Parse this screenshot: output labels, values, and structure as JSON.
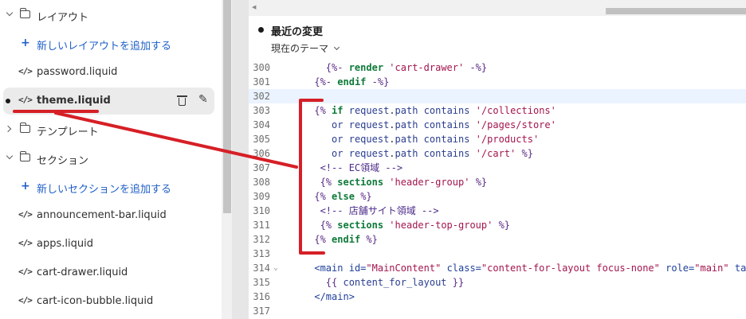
{
  "sidebar": {
    "rows": [
      {
        "type": "folder",
        "expanded": true,
        "label": "レイアウト",
        "icon": "folder-icon"
      },
      {
        "type": "add",
        "label": "新しいレイアウトを追加する",
        "icon": "plus-icon"
      },
      {
        "type": "file",
        "label": "password.liquid",
        "icon": "code-file-icon"
      },
      {
        "type": "file",
        "active": true,
        "modified": true,
        "label": "theme.liquid",
        "icon": "code-file-icon"
      },
      {
        "type": "folder",
        "expanded": false,
        "label": "テンプレート",
        "icon": "folder-icon"
      },
      {
        "type": "folder",
        "expanded": true,
        "label": "セクション",
        "icon": "folder-icon"
      },
      {
        "type": "add",
        "label": "新しいセクションを追加する",
        "icon": "plus-icon"
      },
      {
        "type": "file",
        "label": "announcement-bar.liquid",
        "icon": "code-file-icon"
      },
      {
        "type": "file",
        "label": "apps.liquid",
        "icon": "code-file-icon"
      },
      {
        "type": "file",
        "label": "cart-drawer.liquid",
        "icon": "code-file-icon"
      },
      {
        "type": "file",
        "label": "cart-icon-bubble.liquid",
        "icon": "code-file-icon"
      }
    ],
    "code_icon_glyph": "</>",
    "plus_glyph": "+",
    "pencil_glyph": "✎",
    "accent_color": "#1f5fc7"
  },
  "editor": {
    "changes_title": "最近の変更",
    "theme_select_value": "現在のテーマ",
    "lines": [
      {
        "n": "300",
        "fold": "",
        "hl": false,
        "tokens": [
          [
            "n",
            "        "
          ],
          [
            "p",
            "{%- "
          ],
          [
            "k",
            "render"
          ],
          [
            "n",
            " "
          ],
          [
            "s",
            "'cart-drawer'"
          ],
          [
            "n",
            " "
          ],
          [
            "p",
            "-%}"
          ]
        ]
      },
      {
        "n": "301",
        "fold": "",
        "hl": false,
        "tokens": [
          [
            "n",
            "      "
          ],
          [
            "p",
            "{%- "
          ],
          [
            "k",
            "endif"
          ],
          [
            "n",
            " "
          ],
          [
            "p",
            "-%}"
          ]
        ]
      },
      {
        "n": "302",
        "fold": "",
        "hl": true,
        "tokens": [
          [
            "n",
            ""
          ]
        ]
      },
      {
        "n": "303",
        "fold": "",
        "hl": false,
        "tokens": [
          [
            "n",
            "      "
          ],
          [
            "p",
            "{% "
          ],
          [
            "k",
            "if"
          ],
          [
            "n",
            " "
          ],
          [
            "v",
            "request"
          ],
          [
            "n",
            "."
          ],
          [
            "v",
            "path"
          ],
          [
            "n",
            " "
          ],
          [
            "v",
            "contains"
          ],
          [
            "n",
            " "
          ],
          [
            "s",
            "'/collections'"
          ]
        ]
      },
      {
        "n": "304",
        "fold": "",
        "hl": false,
        "tokens": [
          [
            "n",
            "         "
          ],
          [
            "v",
            "or"
          ],
          [
            "n",
            " "
          ],
          [
            "v",
            "request"
          ],
          [
            "n",
            "."
          ],
          [
            "v",
            "path"
          ],
          [
            "n",
            " "
          ],
          [
            "v",
            "contains"
          ],
          [
            "n",
            " "
          ],
          [
            "s",
            "'/pages/store'"
          ]
        ]
      },
      {
        "n": "305",
        "fold": "",
        "hl": false,
        "tokens": [
          [
            "n",
            "         "
          ],
          [
            "v",
            "or"
          ],
          [
            "n",
            " "
          ],
          [
            "v",
            "request"
          ],
          [
            "n",
            "."
          ],
          [
            "v",
            "path"
          ],
          [
            "n",
            " "
          ],
          [
            "v",
            "contains"
          ],
          [
            "n",
            " "
          ],
          [
            "s",
            "'/products'"
          ]
        ]
      },
      {
        "n": "306",
        "fold": "",
        "hl": false,
        "tokens": [
          [
            "n",
            "         "
          ],
          [
            "v",
            "or"
          ],
          [
            "n",
            " "
          ],
          [
            "v",
            "request"
          ],
          [
            "n",
            "."
          ],
          [
            "v",
            "path"
          ],
          [
            "n",
            " "
          ],
          [
            "v",
            "contains"
          ],
          [
            "n",
            " "
          ],
          [
            "s",
            "'/cart'"
          ],
          [
            "n",
            " "
          ],
          [
            "p",
            "%}"
          ]
        ]
      },
      {
        "n": "307",
        "fold": "",
        "hl": false,
        "tokens": [
          [
            "n",
            "       "
          ],
          [
            "c",
            "<!-- EC領域 -->"
          ]
        ]
      },
      {
        "n": "308",
        "fold": "",
        "hl": false,
        "tokens": [
          [
            "n",
            "       "
          ],
          [
            "p",
            "{% "
          ],
          [
            "k",
            "sections"
          ],
          [
            "n",
            " "
          ],
          [
            "s",
            "'header-group'"
          ],
          [
            "n",
            " "
          ],
          [
            "p",
            "%}"
          ]
        ]
      },
      {
        "n": "309",
        "fold": "",
        "hl": false,
        "tokens": [
          [
            "n",
            "      "
          ],
          [
            "p",
            "{% "
          ],
          [
            "k",
            "else"
          ],
          [
            "n",
            " "
          ],
          [
            "p",
            "%}"
          ]
        ]
      },
      {
        "n": "310",
        "fold": "",
        "hl": false,
        "tokens": [
          [
            "n",
            "       "
          ],
          [
            "c",
            "<!-- 店舗サイト領域 -->"
          ]
        ]
      },
      {
        "n": "311",
        "fold": "",
        "hl": false,
        "tokens": [
          [
            "n",
            "       "
          ],
          [
            "p",
            "{% "
          ],
          [
            "k",
            "sections"
          ],
          [
            "n",
            " "
          ],
          [
            "s",
            "'header-top-group'"
          ],
          [
            "n",
            " "
          ],
          [
            "p",
            "%}"
          ]
        ]
      },
      {
        "n": "312",
        "fold": "",
        "hl": false,
        "tokens": [
          [
            "n",
            "      "
          ],
          [
            "p",
            "{% "
          ],
          [
            "k",
            "endif"
          ],
          [
            "n",
            " "
          ],
          [
            "p",
            "%}"
          ]
        ]
      },
      {
        "n": "313",
        "fold": "",
        "hl": false,
        "tokens": [
          [
            "n",
            ""
          ]
        ]
      },
      {
        "n": "314",
        "fold": "⌄",
        "hl": false,
        "tokens": [
          [
            "n",
            "      "
          ],
          [
            "t",
            "<main"
          ],
          [
            "n",
            " "
          ],
          [
            "a",
            "id="
          ],
          [
            "s",
            "\"MainContent\""
          ],
          [
            "n",
            " "
          ],
          [
            "a",
            "class="
          ],
          [
            "s",
            "\"content-for-layout focus-none\""
          ],
          [
            "n",
            " "
          ],
          [
            "a",
            "role="
          ],
          [
            "s",
            "\"main\""
          ],
          [
            "n",
            " "
          ],
          [
            "a",
            "tabind"
          ]
        ]
      },
      {
        "n": "315",
        "fold": "",
        "hl": false,
        "tokens": [
          [
            "n",
            "        "
          ],
          [
            "p",
            "{{ "
          ],
          [
            "v",
            "content_for_layout"
          ],
          [
            "n",
            " "
          ],
          [
            "p",
            "}}"
          ]
        ]
      },
      {
        "n": "316",
        "fold": "",
        "hl": false,
        "tokens": [
          [
            "n",
            "      "
          ],
          [
            "t",
            "</main>"
          ]
        ]
      },
      {
        "n": "317",
        "fold": "",
        "hl": false,
        "tokens": [
          [
            "n",
            ""
          ]
        ]
      }
    ]
  },
  "annotation_color": "#d61f26",
  "icons": {
    "tree_chevron": "chevron-icon",
    "trash": "trash-icon",
    "edit": "pencil-icon",
    "select_caret": "chevron-down-icon"
  }
}
